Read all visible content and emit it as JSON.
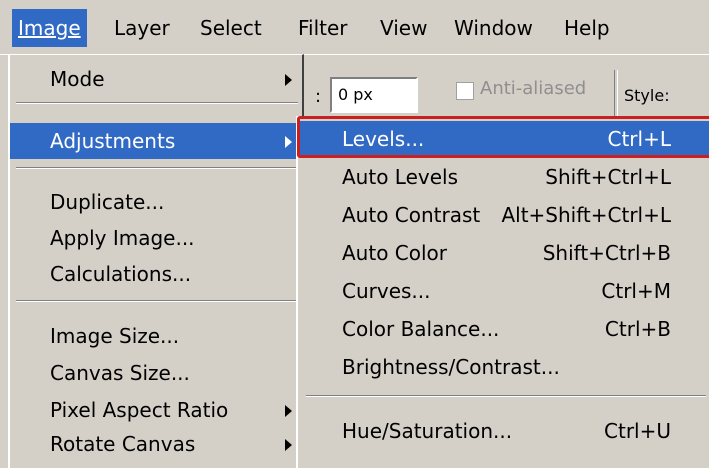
{
  "menubar": {
    "items": [
      {
        "label": "Image"
      },
      {
        "label": "Layer"
      },
      {
        "label": "Select"
      },
      {
        "label": "Filter"
      },
      {
        "label": "View"
      },
      {
        "label": "Window"
      },
      {
        "label": "Help"
      }
    ]
  },
  "toolbar": {
    "colon": ":",
    "feather_value": "0 px",
    "antialias_label": "Anti-aliased",
    "antialias_checked": false,
    "style_label": "Style:"
  },
  "image_menu": {
    "items": [
      {
        "label": "Mode",
        "submenu": true
      },
      {
        "label": "Adjustments",
        "submenu": true,
        "active": true
      },
      {
        "label": "Duplicate..."
      },
      {
        "label": "Apply Image..."
      },
      {
        "label": "Calculations..."
      },
      {
        "label": "Image Size..."
      },
      {
        "label": "Canvas Size..."
      },
      {
        "label": "Pixel Aspect Ratio",
        "submenu": true
      },
      {
        "label": "Rotate Canvas",
        "submenu": true
      }
    ]
  },
  "adjustments_menu": {
    "items": [
      {
        "label": "Levels...",
        "shortcut": "Ctrl+L",
        "active": true
      },
      {
        "label": "Auto Levels",
        "shortcut": "Shift+Ctrl+L"
      },
      {
        "label": "Auto Contrast",
        "shortcut": "Alt+Shift+Ctrl+L"
      },
      {
        "label": "Auto Color",
        "shortcut": "Shift+Ctrl+B"
      },
      {
        "label": "Curves...",
        "shortcut": "Ctrl+M"
      },
      {
        "label": "Color Balance...",
        "shortcut": "Ctrl+B"
      },
      {
        "label": "Brightness/Contrast...",
        "shortcut": ""
      },
      {
        "label": "Hue/Saturation...",
        "shortcut": "Ctrl+U"
      }
    ]
  },
  "colors": {
    "menu_bg": "#d4d0c8",
    "highlight": "#316ac5",
    "annotation_border": "#cc1f1f"
  }
}
